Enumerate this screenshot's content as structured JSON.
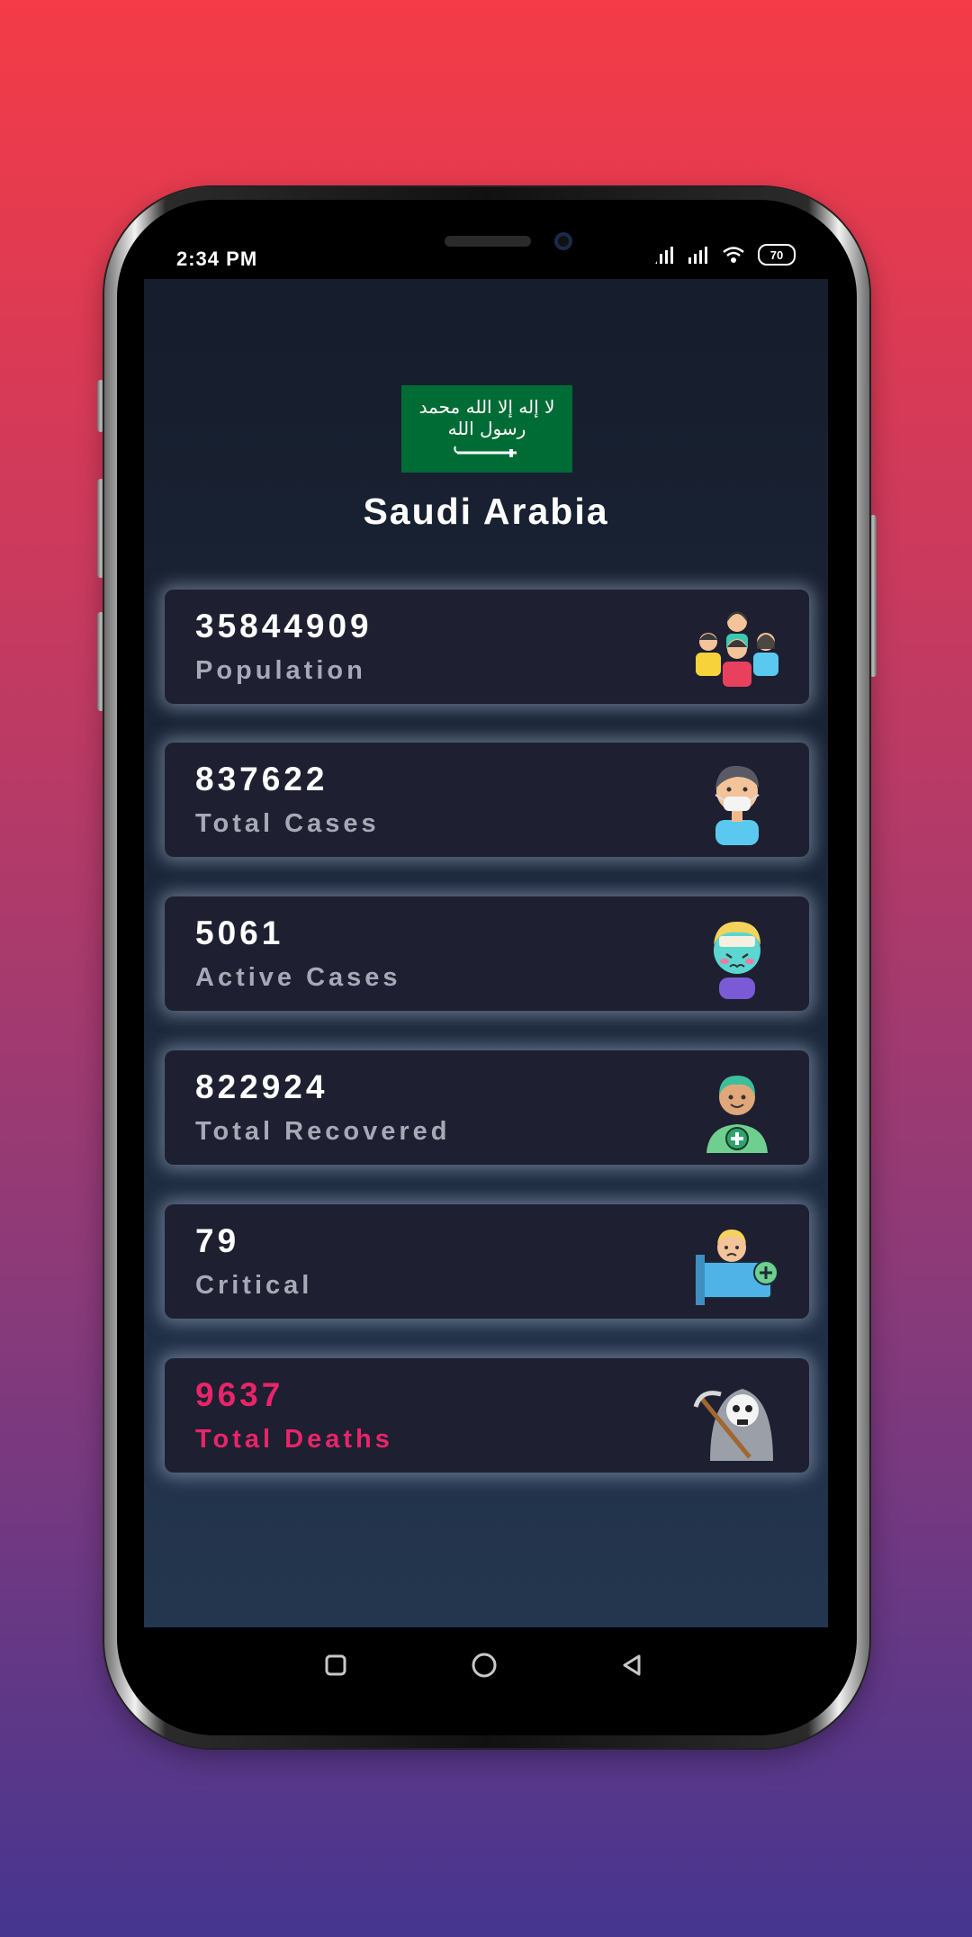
{
  "status": {
    "time": "2:34 PM",
    "battery": "70"
  },
  "country": {
    "name": "Saudi Arabia",
    "flag_text": "لا إله إلا الله محمد رسول الله"
  },
  "stats": [
    {
      "value": "35844909",
      "label": "Population",
      "icon": "people-group-icon"
    },
    {
      "value": "837622",
      "label": "Total Cases",
      "icon": "masked-person-icon"
    },
    {
      "value": "5061",
      "label": "Active Cases",
      "icon": "sick-person-icon"
    },
    {
      "value": "822924",
      "label": "Total Recovered",
      "icon": "recovered-person-icon"
    },
    {
      "value": "79",
      "label": "Critical",
      "icon": "patient-bed-icon"
    },
    {
      "value": "9637",
      "label": "Total Deaths",
      "icon": "grim-reaper-icon",
      "color": "#e8256a"
    }
  ],
  "colors": {
    "accent_deaths": "#e8256a",
    "flag_green": "#006c35",
    "card_bg": "#1e1f30"
  },
  "navbar": {
    "buttons": [
      "recents-button",
      "home-button",
      "back-button"
    ]
  }
}
